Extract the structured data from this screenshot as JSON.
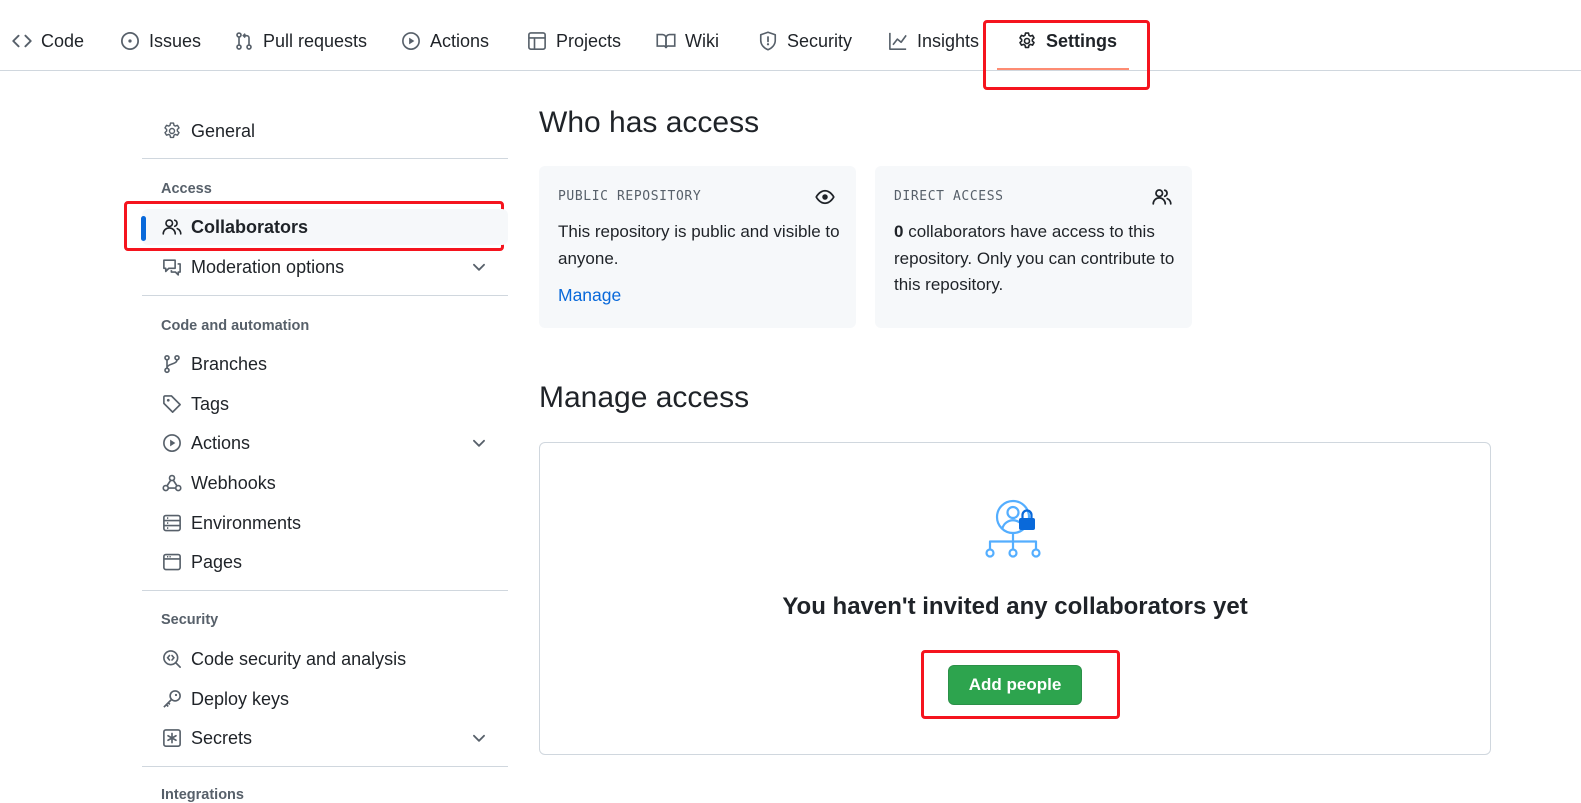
{
  "topnav": {
    "tabs": [
      {
        "label": "Code",
        "icon": "code-icon"
      },
      {
        "label": "Issues",
        "icon": "issue-opened-icon"
      },
      {
        "label": "Pull requests",
        "icon": "git-pull-request-icon"
      },
      {
        "label": "Actions",
        "icon": "play-icon"
      },
      {
        "label": "Projects",
        "icon": "table-icon"
      },
      {
        "label": "Wiki",
        "icon": "book-icon"
      },
      {
        "label": "Security",
        "icon": "shield-icon"
      },
      {
        "label": "Insights",
        "icon": "graph-icon"
      },
      {
        "label": "Settings",
        "icon": "gear-icon",
        "active": true
      }
    ]
  },
  "sidebar": {
    "general": {
      "label": "General",
      "icon": "gear-icon"
    },
    "sections": [
      {
        "heading": "Access",
        "items": [
          {
            "label": "Collaborators",
            "icon": "people-icon",
            "active": true
          },
          {
            "label": "Moderation options",
            "icon": "report-icon",
            "expandable": true
          }
        ]
      },
      {
        "heading": "Code and automation",
        "items": [
          {
            "label": "Branches",
            "icon": "git-branch-icon"
          },
          {
            "label": "Tags",
            "icon": "tag-icon"
          },
          {
            "label": "Actions",
            "icon": "play-icon",
            "expandable": true
          },
          {
            "label": "Webhooks",
            "icon": "webhook-icon"
          },
          {
            "label": "Environments",
            "icon": "server-icon"
          },
          {
            "label": "Pages",
            "icon": "browser-icon"
          }
        ]
      },
      {
        "heading": "Security",
        "items": [
          {
            "label": "Code security and analysis",
            "icon": "codescan-icon"
          },
          {
            "label": "Deploy keys",
            "icon": "key-icon"
          },
          {
            "label": "Secrets",
            "icon": "key-asterisk-icon",
            "expandable": true
          }
        ]
      },
      {
        "heading": "Integrations",
        "items": []
      }
    ]
  },
  "main": {
    "who_has_access": {
      "title": "Who has access",
      "public_card": {
        "title": "PUBLIC REPOSITORY",
        "icon": "eye-icon",
        "text": "This repository is public and visible to anyone.",
        "link": "Manage"
      },
      "direct_card": {
        "title": "DIRECT ACCESS",
        "icon": "people-icon",
        "count": "0",
        "text": " collaborators have access to this repository. Only you can contribute to this repository."
      }
    },
    "manage_access": {
      "title": "Manage access",
      "empty_icon": "collaborators-illustration-icon",
      "empty_title": "You haven't invited any collaborators yet",
      "add_button": "Add people"
    }
  },
  "colors": {
    "accent_blue": "#0969da",
    "primary_green": "#2da44e",
    "highlight_red": "#f5141e",
    "tab_underline": "#fd8c73"
  }
}
